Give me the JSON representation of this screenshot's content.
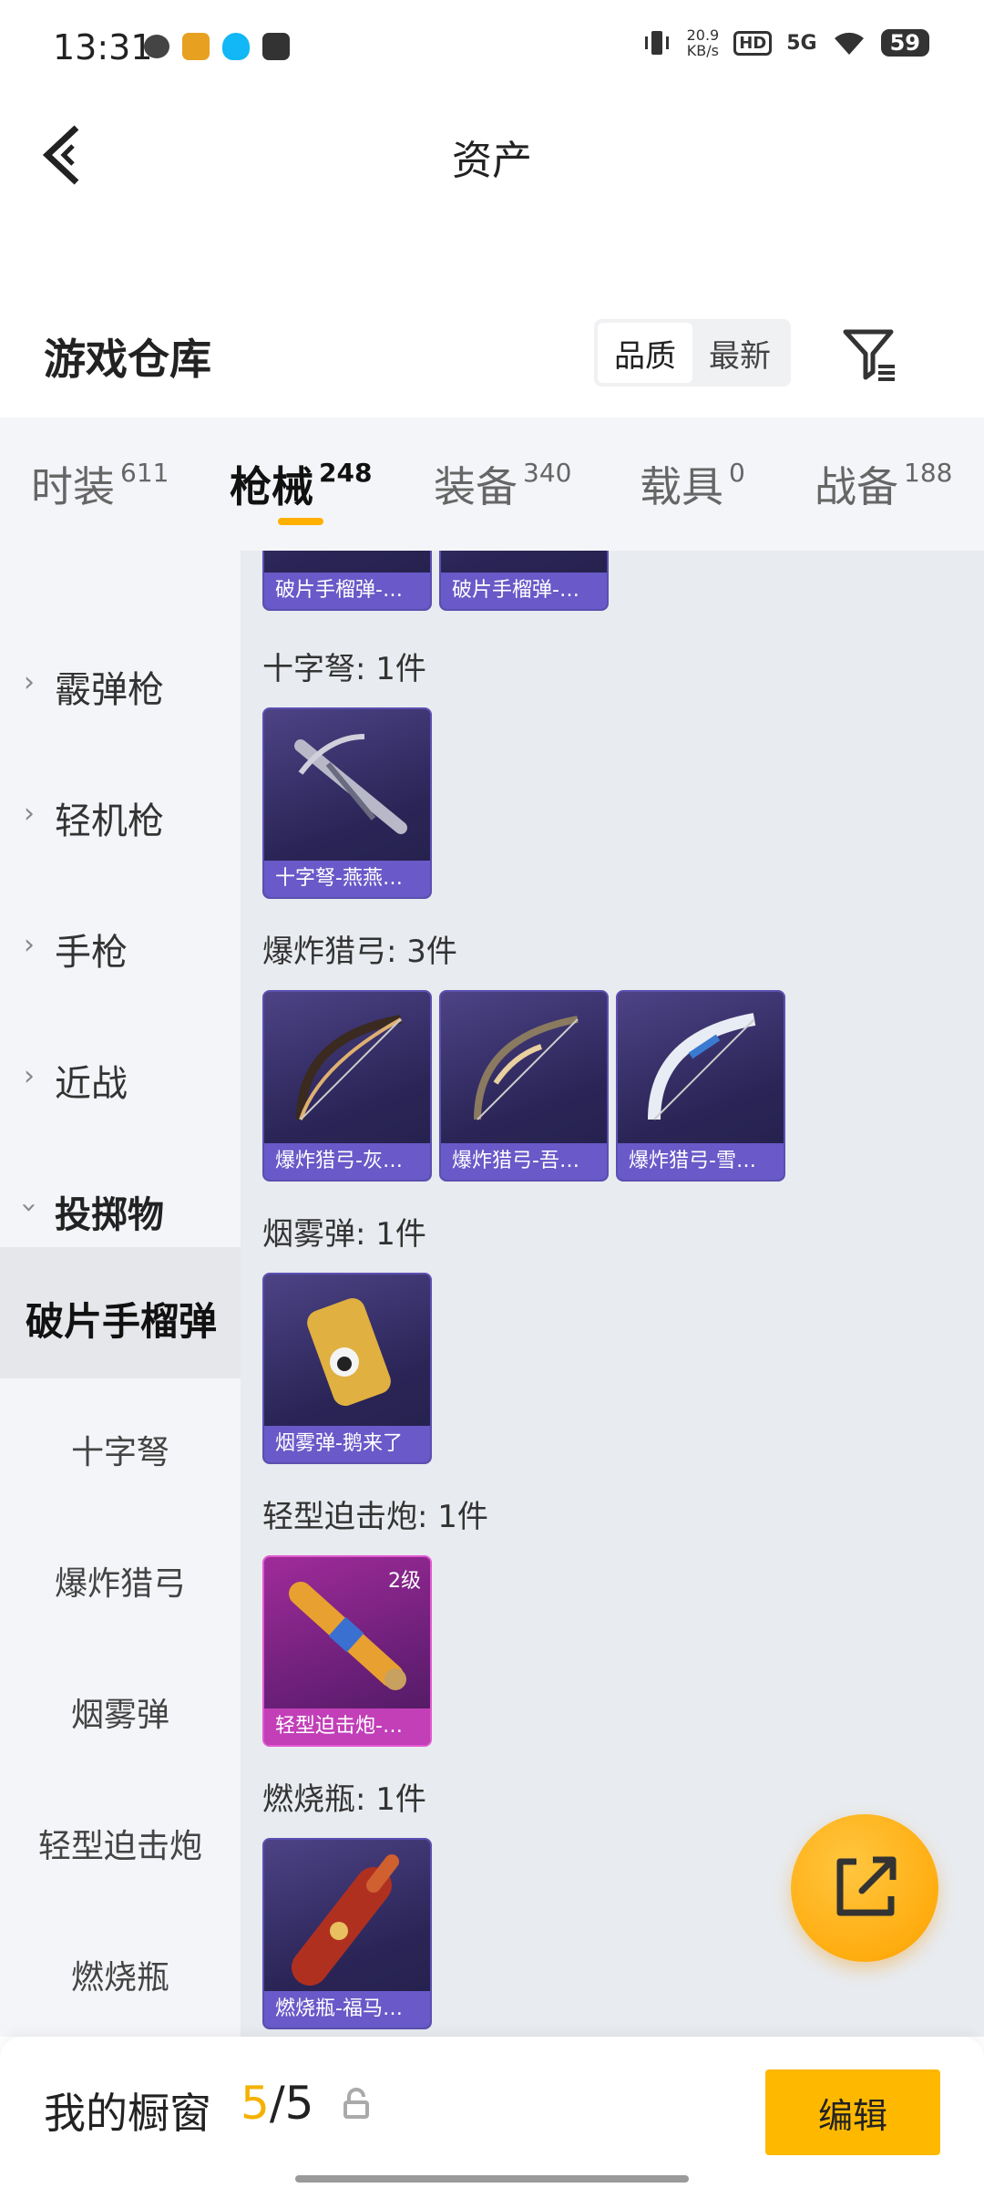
{
  "status_bar": {
    "time": "13:31",
    "net_speed_value": "20.9",
    "net_speed_unit": "KB/s",
    "hd_badge": "HD",
    "signal": "5G",
    "battery": "59"
  },
  "header": {
    "title": "资产",
    "back_icon": "chevron-left-icon"
  },
  "warehouse": {
    "title": "游戏仓库",
    "sort_options": [
      "品质",
      "最新"
    ],
    "sort_selected": "品质",
    "filter_icon": "filter-icon"
  },
  "tabs": [
    {
      "label": "时装",
      "count": "611"
    },
    {
      "label": "枪械",
      "count": "248",
      "active": true
    },
    {
      "label": "装备",
      "count": "340"
    },
    {
      "label": "载具",
      "count": "0"
    },
    {
      "label": "战备",
      "count": "188"
    }
  ],
  "sidebar": {
    "categories": [
      {
        "label": "霰弹枪"
      },
      {
        "label": "轻机枪"
      },
      {
        "label": "手枪"
      },
      {
        "label": "近战"
      },
      {
        "label": "投掷物",
        "expanded": true
      }
    ],
    "subcategories": [
      {
        "label": "破片手榴弹",
        "selected": true
      },
      {
        "label": "十字弩"
      },
      {
        "label": "爆炸猎弓"
      },
      {
        "label": "烟雾弹"
      },
      {
        "label": "轻型迫击炮"
      },
      {
        "label": "燃烧瓶"
      }
    ]
  },
  "content": {
    "top_cards": [
      "破片手榴弹-…",
      "破片手榴弹-…"
    ],
    "groups": [
      {
        "title": "十字弩: 1件",
        "items": [
          {
            "name": "十字弩-燕燕…"
          }
        ]
      },
      {
        "title": "爆炸猎弓: 3件",
        "items": [
          {
            "name": "爆炸猎弓-灰…"
          },
          {
            "name": "爆炸猎弓-吾…"
          },
          {
            "name": "爆炸猎弓-雪…"
          }
        ]
      },
      {
        "title": "烟雾弹: 1件",
        "items": [
          {
            "name": "烟雾弹-鹅来了"
          }
        ]
      },
      {
        "title": "轻型迫击炮: 1件",
        "items": [
          {
            "name": "轻型迫击炮-…",
            "level": "2级"
          }
        ]
      },
      {
        "title": "燃烧瓶: 1件",
        "items": [
          {
            "name": "燃烧瓶-福马…"
          }
        ]
      }
    ]
  },
  "bottom_bar": {
    "label": "我的橱窗",
    "count_current": "5",
    "count_sep": "/",
    "count_total": "5",
    "edit_label": "编辑"
  },
  "colors": {
    "accent": "#ffb800",
    "card_purple": "#2b2557",
    "card_pink": "#a02b9a"
  }
}
